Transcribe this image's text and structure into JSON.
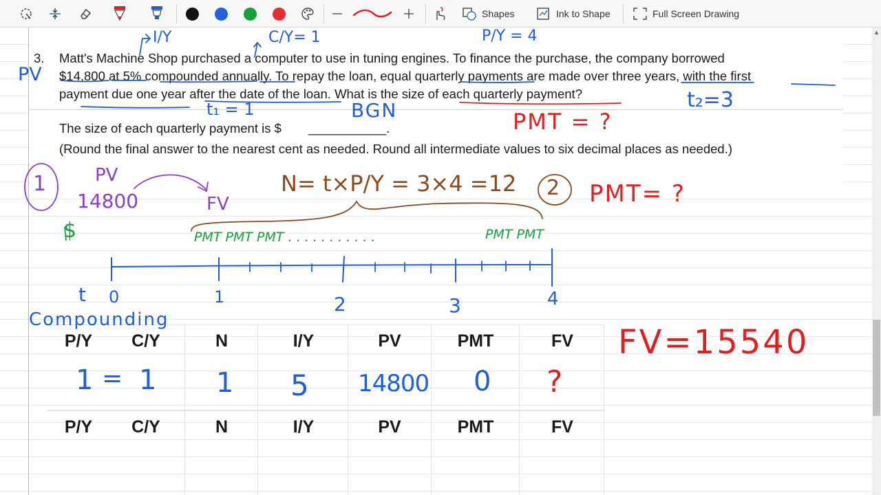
{
  "toolbar": {
    "tools": [
      {
        "name": "lasso-select-icon"
      },
      {
        "name": "insert-space-icon"
      },
      {
        "name": "eraser-icon"
      },
      {
        "name": "pen-red-icon"
      },
      {
        "name": "highlighter-blue-icon"
      }
    ],
    "colors": [
      "#111111",
      "#1f62e0",
      "#18a03a",
      "#e62e2e"
    ],
    "shapes_label": "Shapes",
    "ink_to_shape_label": "Ink to Shape",
    "full_screen_label": "Full Screen Drawing"
  },
  "question": {
    "number": "3.",
    "line1": "Matt's Machine Shop purchased a computer to use in tuning engines. To finance the purchase, the company borrowed",
    "line2": "$14,800 at 5% compounded annually. To repay the loan, equal quarterly payments are made over three years, with the first",
    "line3": "payment due one year after the date of the loan. What is the size of each quarterly payment?",
    "answer_prompt": "The size of each quarterly payment is $",
    "answer_blank": "___________.",
    "rounding_note": "(Round the final answer to the nearest cent as needed. Round all intermediate values to six decimal places as needed.)"
  },
  "table_headers": [
    "P/Y",
    "C/Y",
    "N",
    "I/Y",
    "PV",
    "PMT",
    "FV"
  ],
  "handwriting": {
    "pv_margin": "PV",
    "iy_note": "I/Y",
    "cy_note": "C/Y= 1",
    "py_note": "P/Y = 4",
    "t1_note": "t₁ = 1",
    "bgn_note": "BGN",
    "t2_note": "t₂=3",
    "pmt_q1": "PMT = ?",
    "step1": "1",
    "pv_label": "PV",
    "pv_value": "14800",
    "fv_label": "FV",
    "dollar": "$",
    "n_formula": "N= t×P/Y = 3×4 =12",
    "step2": "2",
    "pmt_q2": "PMT= ?",
    "pmt_left": "PMT PMT PMT  . . . . . . . . . . .",
    "pmt_right": "PMT PMT",
    "t_label": "t",
    "timeline_ticks": [
      "0",
      "1",
      "2",
      "3",
      "4"
    ],
    "compounding": "Compounding",
    "row1": [
      "1",
      "=",
      "1",
      "1",
      "5",
      "14800",
      "0",
      "?"
    ],
    "fv_result": "FV=15540"
  }
}
